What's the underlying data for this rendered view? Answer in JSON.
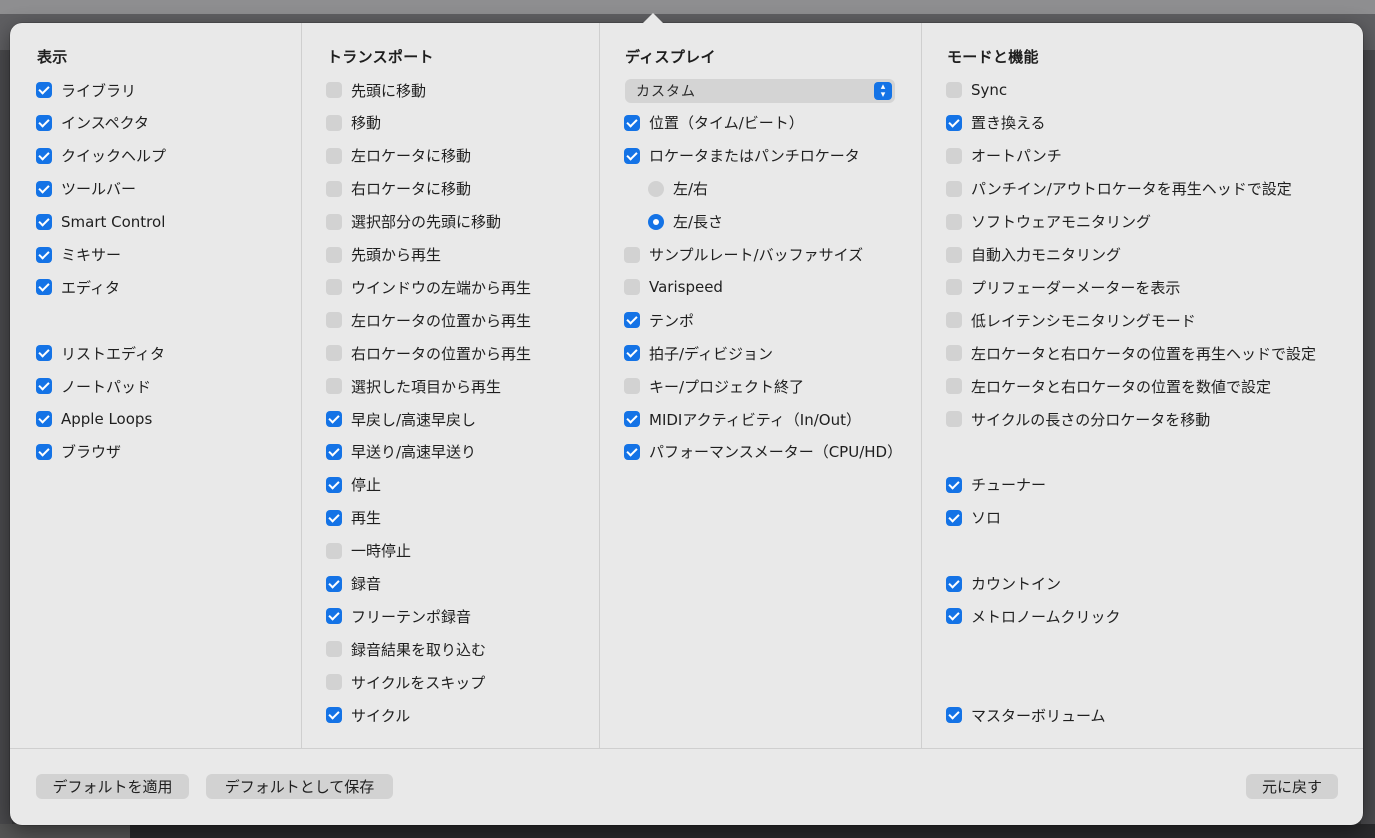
{
  "columns": {
    "display": {
      "title": "表示",
      "items": [
        {
          "label": "ライブラリ",
          "checked": true
        },
        {
          "label": "インスペクタ",
          "checked": true
        },
        {
          "label": "クイックヘルプ",
          "checked": true
        },
        {
          "label": "ツールバー",
          "checked": true
        },
        {
          "label": "Smart Control",
          "checked": true
        },
        {
          "label": "ミキサー",
          "checked": true
        },
        {
          "label": "エディタ",
          "checked": true
        },
        {
          "label": "リストエディタ",
          "checked": true
        },
        {
          "label": "ノートパッド",
          "checked": true
        },
        {
          "label": "Apple Loops",
          "checked": true
        },
        {
          "label": "ブラウザ",
          "checked": true
        }
      ]
    },
    "transport": {
      "title": "トランスポート",
      "items": [
        {
          "label": "先頭に移動",
          "checked": false
        },
        {
          "label": "移動",
          "checked": false
        },
        {
          "label": "左ロケータに移動",
          "checked": false
        },
        {
          "label": "右ロケータに移動",
          "checked": false
        },
        {
          "label": "選択部分の先頭に移動",
          "checked": false
        },
        {
          "label": "先頭から再生",
          "checked": false
        },
        {
          "label": "ウインドウの左端から再生",
          "checked": false
        },
        {
          "label": "左ロケータの位置から再生",
          "checked": false
        },
        {
          "label": "右ロケータの位置から再生",
          "checked": false
        },
        {
          "label": "選択した項目から再生",
          "checked": false
        },
        {
          "label": "早戻し/高速早戻し",
          "checked": true
        },
        {
          "label": "早送り/高速早送り",
          "checked": true
        },
        {
          "label": "停止",
          "checked": true
        },
        {
          "label": "再生",
          "checked": true
        },
        {
          "label": "一時停止",
          "checked": false
        },
        {
          "label": "録音",
          "checked": true
        },
        {
          "label": "フリーテンポ録音",
          "checked": true
        },
        {
          "label": "録音結果を取り込む",
          "checked": false
        },
        {
          "label": "サイクルをスキップ",
          "checked": false
        },
        {
          "label": "サイクル",
          "checked": true
        }
      ]
    },
    "lcd": {
      "title": "ディスプレイ",
      "popup_value": "カスタム",
      "items": [
        {
          "label": "位置（タイム/ビート）",
          "checked": true
        },
        {
          "label": "ロケータまたはパンチロケータ",
          "checked": true
        },
        {
          "label": "左/右",
          "checked": false
        },
        {
          "label": "左/長さ",
          "checked": true
        },
        {
          "label": "サンプルレート/バッファサイズ",
          "checked": false
        },
        {
          "label": "Varispeed",
          "checked": false
        },
        {
          "label": "テンポ",
          "checked": true
        },
        {
          "label": "拍子/ディビジョン",
          "checked": true
        },
        {
          "label": "キー/プロジェクト終了",
          "checked": false
        },
        {
          "label": "MIDIアクティビティ（In/Out）",
          "checked": true
        },
        {
          "label": "パフォーマンスメーター（CPU/HD）",
          "checked": true
        }
      ]
    },
    "modes": {
      "title": "モードと機能",
      "items": [
        {
          "label": "Sync",
          "checked": false
        },
        {
          "label": "置き換える",
          "checked": true
        },
        {
          "label": "オートパンチ",
          "checked": false
        },
        {
          "label": "パンチイン/アウトロケータを再生ヘッドで設定",
          "checked": false
        },
        {
          "label": "ソフトウェアモニタリング",
          "checked": false
        },
        {
          "label": "自動入力モニタリング",
          "checked": false
        },
        {
          "label": "プリフェーダーメーターを表示",
          "checked": false
        },
        {
          "label": "低レイテンシモニタリングモード",
          "checked": false
        },
        {
          "label": "左ロケータと右ロケータの位置を再生ヘッドで設定",
          "checked": false
        },
        {
          "label": "左ロケータと右ロケータの位置を数値で設定",
          "checked": false
        },
        {
          "label": "サイクルの長さの分ロケータを移動",
          "checked": false
        },
        {
          "label": "チューナー",
          "checked": true
        },
        {
          "label": "ソロ",
          "checked": true
        },
        {
          "label": "カウントイン",
          "checked": true
        },
        {
          "label": "メトロノームクリック",
          "checked": true
        },
        {
          "label": "マスターボリューム",
          "checked": true
        }
      ]
    }
  },
  "footer": {
    "apply_defaults": "デフォルトを適用",
    "save_defaults": "デフォルトとして保存",
    "revert": "元に戻す"
  },
  "colors": {
    "accent": "#1473e6",
    "panel": "#e9e9e9"
  }
}
